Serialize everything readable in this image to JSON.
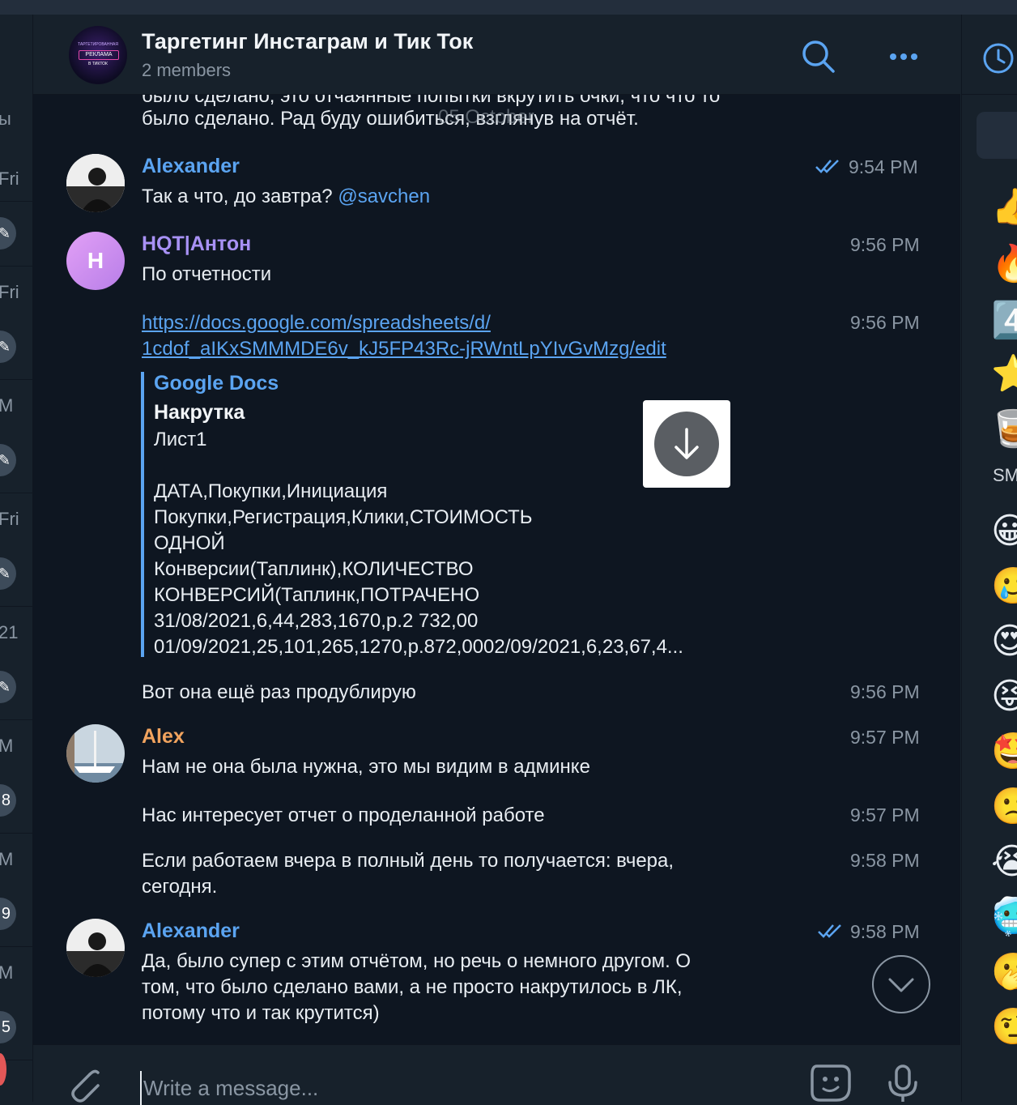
{
  "left_list": {
    "items": [
      {
        "label": "ы"
      },
      {
        "label": "Fri",
        "badge": "pin"
      },
      {
        "label": "Fri",
        "badge": "pin"
      },
      {
        "label": "M",
        "badge": "pin"
      },
      {
        "label": "Fri",
        "badge": "pin"
      },
      {
        "label": "21",
        "badge": "pin"
      },
      {
        "label": "M",
        "badge": "8"
      },
      {
        "label": "M",
        "badge": "9"
      },
      {
        "label": "M",
        "badge": "5"
      }
    ]
  },
  "header": {
    "title": "Таргетинг Инстаграм и Тик Ток",
    "subtitle": "2 members",
    "avatar_text": "РЕКЛАМА",
    "avatar_sub": "ТАРГЕТИРОВАННАЯ",
    "avatar_sub2": "В ТИКТОК"
  },
  "chat": {
    "date_pill": "05 October",
    "partial_top_line": "было сделано, это отчаянные попытки вкрутить очки, что что то",
    "partial_top_line2": "было сделано. Рад буду ошибиться, взглянув на отчёт.",
    "messages": [
      {
        "sender": "Alexander",
        "text_before": "Так а что, до завтра? ",
        "mention": "@savchen",
        "time": "9:54 PM",
        "read": true
      },
      {
        "sender": "HQT|Антон",
        "avatar_letter": "H",
        "text": "По отчетности",
        "time": "9:56 PM"
      },
      {
        "link_line1": "https://docs.google.com/spreadsheets/d/",
        "link_line2": "1cdof_aIKxSMMMDE6v_kJ5FP43Rc-jRWntLpYIvGvMzg/edit",
        "time": "9:56 PM"
      },
      {
        "text": "Вот она ещё раз продублирую",
        "time": "9:56 PM"
      },
      {
        "sender": "Alex",
        "text": "Нам не она была нужна, это мы видим в админке",
        "time": "9:57 PM"
      },
      {
        "text": "Нас интересует отчет о проделанной работе",
        "time": "9:57 PM"
      },
      {
        "text_line1": "Если работаем вчера в полный день то получается: вчера,",
        "text_line2": "сегодня.",
        "time": "9:58 PM"
      },
      {
        "sender": "Alexander",
        "text_line1": "Да, было супер с этим отчётом, но речь о немного другом. О",
        "text_line2": "том, что было сделано вами, а не просто накрутилось в ЛК,",
        "text_line3": "потому что и так крутится)",
        "time": "9:58 PM",
        "read": true
      }
    ],
    "preview": {
      "site": "Google Docs",
      "title": "Накрутка",
      "body": "Лист1\n\nДАТА,Покупки,Инициация\nПокупки,Регистрация,Клики,СТОИМОСТЬ\nОДНОЙ\nКонверсии(Таплинк),КОЛИЧЕСТВО\nКОНВЕРСИЙ(Таплинк,ПОТРАЧЕНО\n31/08/2021,6,44,283,1670,р.2 732,00\n01/09/2021,25,101,265,1270,р.872,0002/09/2021,6,23,67,4..."
    }
  },
  "composer": {
    "placeholder": "Write a message..."
  },
  "right_panel": {
    "section_label": "SM",
    "emojis": [
      "👍",
      "🔥",
      "4️⃣",
      "⭐",
      "🥃",
      "😀",
      "🥲",
      "😍",
      "😝",
      "🤩",
      "🙁",
      "😭",
      "🥶",
      "🫢",
      "🤨"
    ]
  },
  "colors": {
    "bg": "#0e1621",
    "panel": "#17212b",
    "accent": "#5ba4f1",
    "name_hqt": "#a891f5",
    "name_alex": "#f1a35e",
    "secondary_text": "#8a96a3"
  }
}
